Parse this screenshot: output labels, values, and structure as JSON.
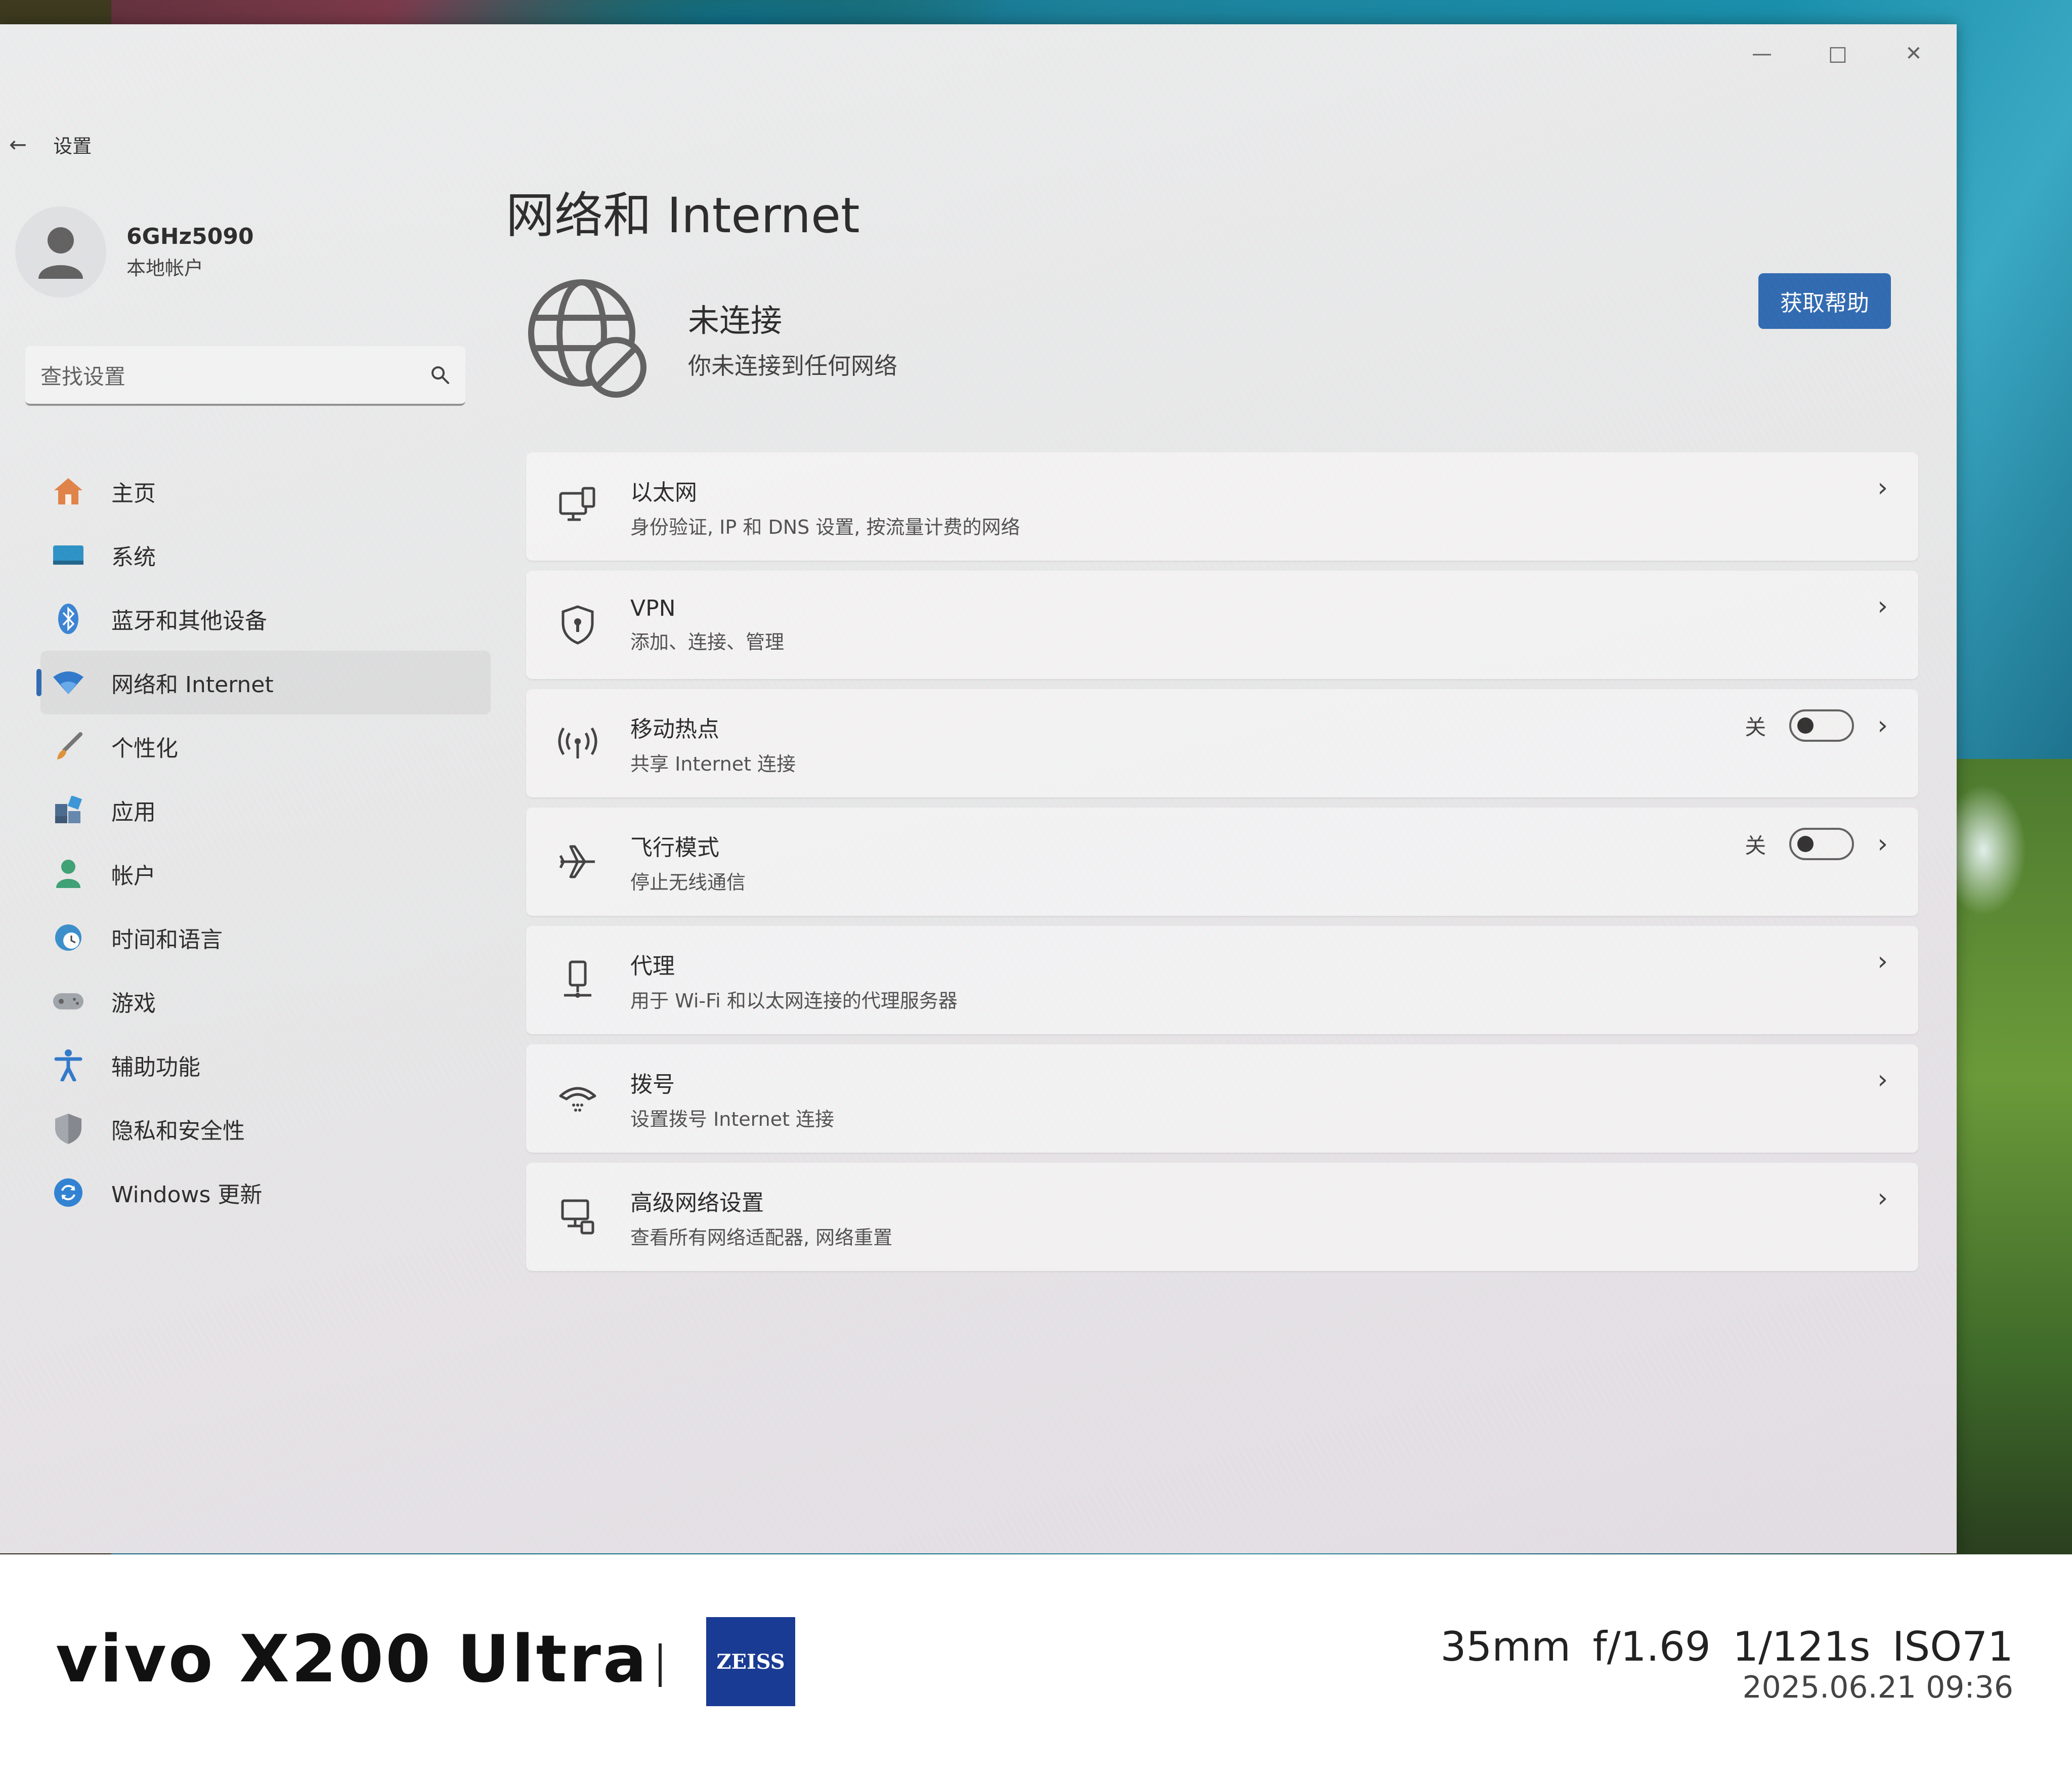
{
  "window": {
    "title": "设置",
    "caption_buttons": [
      "minimize-icon",
      "maximize-icon",
      "close-icon"
    ]
  },
  "profile": {
    "name": "6GHz5090",
    "account_type": "本地帐户"
  },
  "search": {
    "placeholder": "查找设置"
  },
  "sidebar": {
    "items": [
      {
        "label": "主页",
        "icon": "home-icon",
        "active": false
      },
      {
        "label": "系统",
        "icon": "system-icon",
        "active": false
      },
      {
        "label": "蓝牙和其他设备",
        "icon": "bluetooth-icon",
        "active": false
      },
      {
        "label": "网络和 Internet",
        "icon": "wifi-icon",
        "active": true
      },
      {
        "label": "个性化",
        "icon": "brush-icon",
        "active": false
      },
      {
        "label": "应用",
        "icon": "apps-icon",
        "active": false
      },
      {
        "label": "帐户",
        "icon": "account-icon",
        "active": false
      },
      {
        "label": "时间和语言",
        "icon": "clock-globe-icon",
        "active": false
      },
      {
        "label": "游戏",
        "icon": "gamepad-icon",
        "active": false
      },
      {
        "label": "辅助功能",
        "icon": "accessibility-icon",
        "active": false
      },
      {
        "label": "隐私和安全性",
        "icon": "shield-icon",
        "active": false
      },
      {
        "label": "Windows 更新",
        "icon": "update-icon",
        "active": false
      }
    ]
  },
  "main": {
    "title": "网络和 Internet",
    "status": {
      "title": "未连接",
      "subtitle": "你未连接到任何网络",
      "icon": "globe-disconnected-icon"
    },
    "help_button": "获取帮助",
    "cards": [
      {
        "title": "以太网",
        "subtitle": "身份验证, IP 和 DNS 设置, 按流量计费的网络",
        "icon": "ethernet-icon"
      },
      {
        "title": "VPN",
        "subtitle": "添加、连接、管理",
        "icon": "vpn-shield-icon"
      },
      {
        "title": "移动热点",
        "subtitle": "共享 Internet 连接",
        "icon": "hotspot-icon",
        "toggle_state": "关",
        "toggle_on": false
      },
      {
        "title": "飞行模式",
        "subtitle": "停止无线通信",
        "icon": "airplane-icon",
        "toggle_state": "关",
        "toggle_on": false
      },
      {
        "title": "代理",
        "subtitle": "用于 Wi-Fi 和以太网连接的代理服务器",
        "icon": "proxy-icon"
      },
      {
        "title": "拨号",
        "subtitle": "设置拨号 Internet 连接",
        "icon": "dialup-icon"
      },
      {
        "title": "高级网络设置",
        "subtitle": "查看所有网络适配器, 网络重置",
        "icon": "advanced-network-icon"
      }
    ]
  },
  "camera_watermark": {
    "brand": "vivo X200 Ultra",
    "lens_brand": "ZEISS",
    "params": "35mm  f/1.69  1/121s  ISO71",
    "datetime": "2025.06.21 09:36"
  },
  "colors": {
    "accent": "#1f5fad",
    "window_bg": "#eceeee",
    "zeiss_blue": "#1a3b93"
  }
}
